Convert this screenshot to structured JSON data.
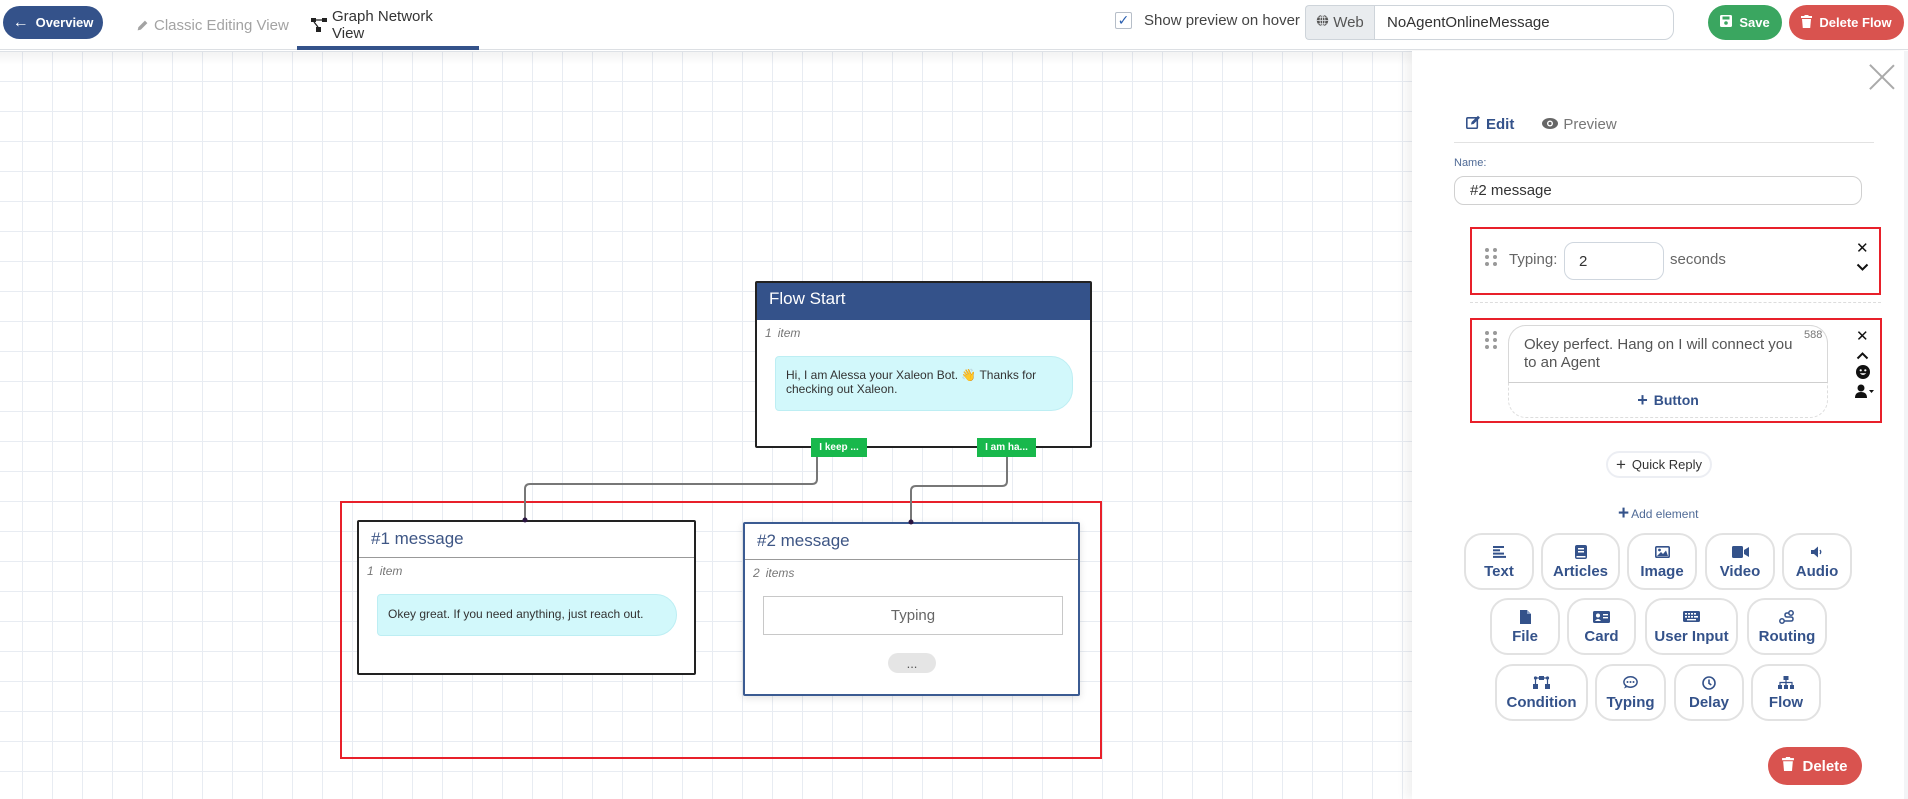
{
  "header": {
    "overview_label": "Overview",
    "tabs": [
      {
        "label": "Classic Editing View",
        "icon": "pencil-icon",
        "active": false
      },
      {
        "label": "Graph Network View",
        "icon": "sitemap-icon",
        "active": true
      }
    ],
    "show_preview_label": "Show preview on hover",
    "show_preview_checked": true,
    "channel_label": "Web",
    "flow_name_value": "NoAgentOnlineMessage",
    "save_label": "Save",
    "delete_flow_label": "Delete Flow"
  },
  "graph": {
    "flow_start": {
      "title": "Flow Start",
      "count": "1",
      "count_unit": "item",
      "message": "Hi, I am Alessa your Xaleon Bot. 👋 Thanks for checking out Xaleon.",
      "outputs": [
        "I keep ...",
        "I am ha..."
      ]
    },
    "message1": {
      "title": "#1 message",
      "count": "1",
      "count_unit": "item",
      "message": "Okey great. If you need anything, just reach out."
    },
    "message2": {
      "title": "#2 message",
      "count": "2",
      "count_unit": "items",
      "typing_label": "Typing",
      "more_label": "..."
    }
  },
  "panel": {
    "tabs": [
      {
        "label": "Edit",
        "icon": "edit-icon",
        "active": true
      },
      {
        "label": "Preview",
        "icon": "eye-icon",
        "active": false
      }
    ],
    "name_label": "Name:",
    "name_value": "#2 message",
    "typing_element": {
      "label": "Typing:",
      "value": "2",
      "unit": "seconds"
    },
    "text_element": {
      "value": "Okey perfect. Hang on I will connect you to an Agent",
      "char_count": "588",
      "add_button_label": "Button"
    },
    "quick_reply_label": "Quick Reply",
    "add_element_label": "Add element",
    "element_types": [
      {
        "label": "Text",
        "icon": "align-left-icon"
      },
      {
        "label": "Articles",
        "icon": "book-icon"
      },
      {
        "label": "Image",
        "icon": "image-icon"
      },
      {
        "label": "Video",
        "icon": "video-icon"
      },
      {
        "label": "Audio",
        "icon": "volume-icon"
      },
      {
        "label": "File",
        "icon": "file-icon"
      },
      {
        "label": "Card",
        "icon": "id-card-icon"
      },
      {
        "label": "User Input",
        "icon": "keyboard-icon"
      },
      {
        "label": "Routing",
        "icon": "route-icon"
      },
      {
        "label": "Condition",
        "icon": "project-diagram-icon"
      },
      {
        "label": "Typing",
        "icon": "comment-dots-icon"
      },
      {
        "label": "Delay",
        "icon": "clock-icon"
      },
      {
        "label": "Flow",
        "icon": "sitemap-icon"
      }
    ],
    "delete_label": "Delete"
  },
  "colors": {
    "brand": "#34528a",
    "save": "#3aa660",
    "danger": "#d9534f",
    "output_button": "#18b84c",
    "bubble": "#d2f8fb",
    "highlight": "#e8202a"
  }
}
